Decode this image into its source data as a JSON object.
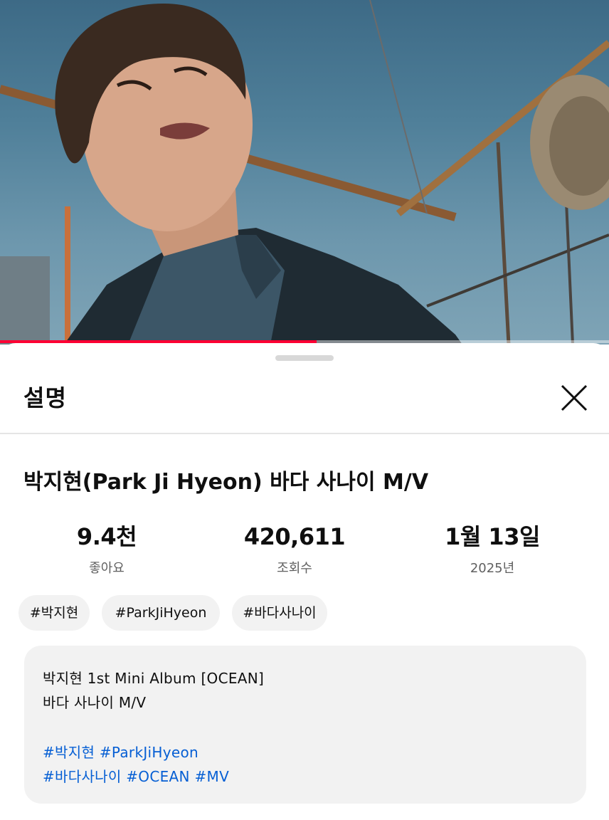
{
  "player": {
    "progress_fraction": 0.52,
    "accent_color": "#ff0033"
  },
  "sheet": {
    "title": "설명",
    "close_icon": "close-icon"
  },
  "video": {
    "title": "박지현(Park Ji Hyeon) 바다 사나이 M/V"
  },
  "stats": [
    {
      "value": "9.4천",
      "label": "좋아요"
    },
    {
      "value": "420,611",
      "label": "조회수"
    },
    {
      "value": "1월 13일",
      "label": "2025년"
    }
  ],
  "chips": [
    "#박지현",
    "#ParkJiHyeon",
    "#바다사나이"
  ],
  "description": {
    "line1": "박지현 1st Mini Album [OCEAN]",
    "line2": "바다 사나이 M/V",
    "tags1": [
      "#박지현",
      "#ParkJiHyeon"
    ],
    "tags2": [
      "#바다사나이",
      "#OCEAN",
      "#MV"
    ],
    "link_color": "#065fd4"
  }
}
